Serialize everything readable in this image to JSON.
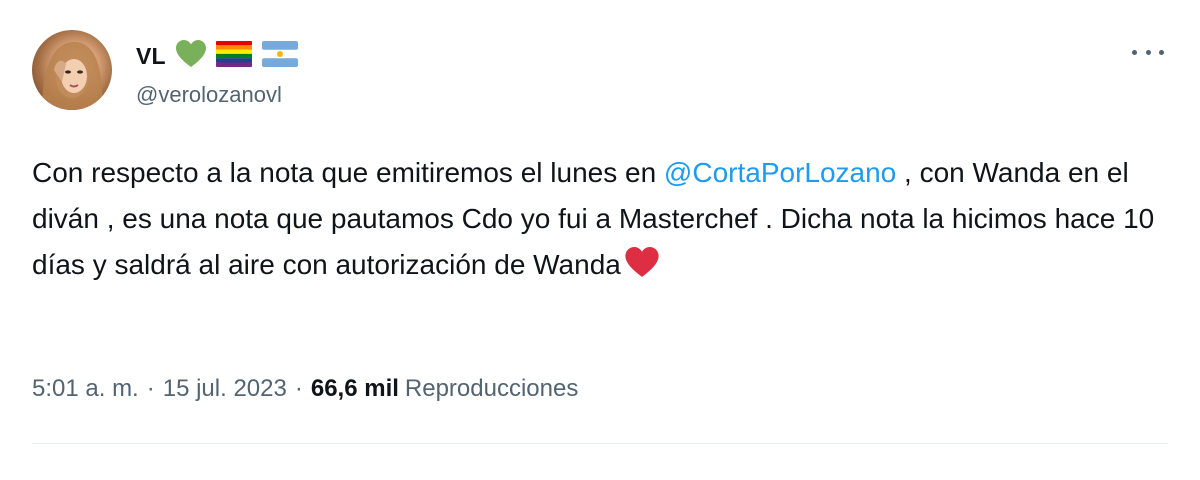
{
  "author": {
    "display_name": "VL",
    "emojis": [
      "green-heart",
      "rainbow-flag",
      "argentina-flag"
    ],
    "handle": "@verolozanovl"
  },
  "tweet": {
    "text_1": "Con respecto a la nota que emitiremos el lunes en ",
    "mention": "@CortaPorLozano",
    "text_2": " , con Wanda en el diván , es una nota que pautamos Cdo yo fui a Masterchef . Dicha nota la hicimos hace 10 días y saldrá al aire con autorización de Wanda",
    "trailing_emoji": "red-heart"
  },
  "meta": {
    "time": "5:01 a. m.",
    "separator": "·",
    "date": "15 jul. 2023",
    "views_count": "66,6 mil",
    "views_label": "Reproducciones"
  },
  "colors": {
    "text": "#0f1419",
    "secondary": "#536471",
    "link": "#1d9bf0",
    "green_heart": "#78b159",
    "red_heart": "#dd2e44"
  }
}
